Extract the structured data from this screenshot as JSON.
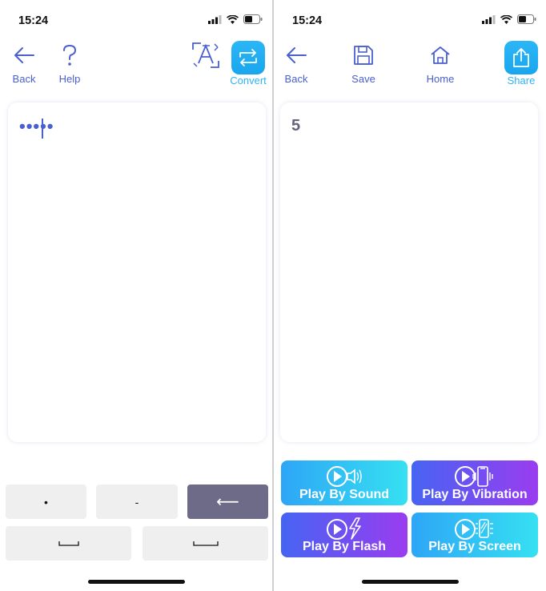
{
  "left_screen": {
    "status_time": "15:24",
    "toolbar": {
      "back_label": "Back",
      "help_label": "Help",
      "convert_label": "Convert"
    },
    "input_text": "•••••",
    "keys": {
      "dot_label": "•",
      "dash_label": "-",
      "backspace_label": "⟵"
    }
  },
  "right_screen": {
    "status_time": "15:24",
    "toolbar": {
      "back_label": "Back",
      "save_label": "Save",
      "home_label": "Home",
      "share_label": "Share"
    },
    "output_text": "5",
    "play_buttons": {
      "sound_label": "Play By Sound",
      "vibration_label": "Play By Vibration",
      "flash_label": "Play By Flash",
      "screen_label": "Play By Screen"
    }
  },
  "colors": {
    "accent": "#4a5fd0",
    "active": "#2fb3f3",
    "backspace_key": "#6e6b88",
    "key_bg": "#efeff0"
  },
  "icons": [
    "back-arrow-icon",
    "help-icon",
    "translate-icon",
    "convert-icon",
    "save-icon",
    "home-icon",
    "share-icon",
    "sound-icon",
    "vibration-icon",
    "flash-icon",
    "screen-icon"
  ]
}
